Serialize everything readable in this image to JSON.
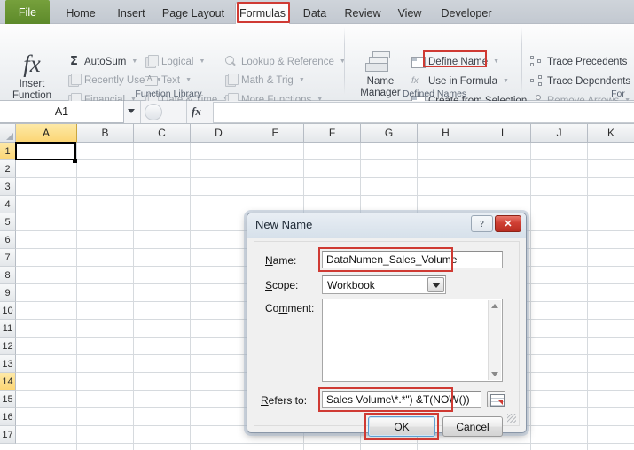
{
  "ribbon": {
    "tabs": [
      {
        "label": "File",
        "kind": "file"
      },
      {
        "label": "Home",
        "kind": "normal"
      },
      {
        "label": "Insert",
        "kind": "normal"
      },
      {
        "label": "Page Layout",
        "kind": "normal"
      },
      {
        "label": "Formulas",
        "kind": "active"
      },
      {
        "label": "Data",
        "kind": "normal"
      },
      {
        "label": "Review",
        "kind": "normal"
      },
      {
        "label": "View",
        "kind": "normal"
      },
      {
        "label": "Developer",
        "kind": "normal"
      }
    ],
    "groups": [
      {
        "label": "Function Library"
      },
      {
        "label": "Defined Names"
      },
      {
        "label": "For"
      }
    ],
    "insert_function": {
      "line1": "Insert",
      "line2": "Function",
      "icon": "fx-icon"
    },
    "name_manager": {
      "line1": "Name",
      "line2": "Manager",
      "icon": "name-manager-icon"
    },
    "function_library_items": [
      {
        "label": "AutoSum",
        "icon": "sigma-icon",
        "caret": true,
        "enabled": true
      },
      {
        "label": "Recently Used",
        "icon": "book-icon",
        "caret": true,
        "enabled": false
      },
      {
        "label": "Financial",
        "icon": "book-icon",
        "caret": true,
        "enabled": false
      },
      {
        "label": "Logical",
        "icon": "book-icon",
        "caret": true,
        "enabled": false
      },
      {
        "label": "Text",
        "icon": "text-icon",
        "caret": true,
        "enabled": false
      },
      {
        "label": "Date & Time",
        "icon": "book-icon",
        "caret": true,
        "enabled": false
      },
      {
        "label": "Lookup & Reference",
        "icon": "lookup-icon",
        "caret": true,
        "enabled": false
      },
      {
        "label": "Math & Trig",
        "icon": "book-icon",
        "caret": true,
        "enabled": false
      },
      {
        "label": "More Functions",
        "icon": "book-icon",
        "caret": true,
        "enabled": false
      }
    ],
    "defined_names_items": [
      {
        "label": "Define Name",
        "icon": "define-name-icon",
        "caret": true,
        "highlighted": true
      },
      {
        "label": "Use in Formula",
        "icon": "use-in-formula-icon",
        "caret": true,
        "highlighted": false
      },
      {
        "label": "Create from Selection",
        "icon": "create-from-selection-icon",
        "caret": false,
        "highlighted": false
      }
    ],
    "formula_auditing_items": [
      {
        "label": "Trace Precedents",
        "icon": "trace-precedents-icon",
        "caret": false
      },
      {
        "label": "Trace Dependents",
        "icon": "trace-dependents-icon",
        "caret": false
      },
      {
        "label": "Remove Arrows",
        "icon": "remove-arrows-icon",
        "caret": true
      }
    ]
  },
  "formula_bar": {
    "name_box_value": "A1",
    "fx_label": "fx",
    "formula_value": ""
  },
  "grid": {
    "columns": [
      "A",
      "B",
      "C",
      "D",
      "E",
      "F",
      "G",
      "H",
      "I",
      "J",
      "K"
    ],
    "selected_column": "A",
    "rows": [
      "1",
      "2",
      "3",
      "4",
      "5",
      "6",
      "7",
      "8",
      "9",
      "10",
      "11",
      "12",
      "13",
      "14",
      "15",
      "16",
      "17"
    ],
    "highlighted_rows": [
      "1",
      "14"
    ],
    "active_cell": "A1"
  },
  "dialog": {
    "title": "New Name",
    "help_label": "?",
    "close_label": "✕",
    "fields": {
      "name": {
        "label": "Name:",
        "underline": "N",
        "value": "DataNumen_Sales_Volume",
        "highlighted": true
      },
      "scope": {
        "label": "Scope:",
        "underline": "S",
        "value": "Workbook",
        "options": [
          "Workbook"
        ]
      },
      "comment": {
        "label": "Comment:",
        "underline": "m",
        "value": ""
      },
      "refers_to": {
        "label": "Refers to:",
        "underline": "R",
        "value": "Sales Volume\\*.*\") &T(NOW())",
        "highlighted": true
      }
    },
    "buttons": {
      "ok": {
        "label": "OK",
        "highlighted": true
      },
      "cancel": {
        "label": "Cancel",
        "highlighted": false
      }
    }
  },
  "colors": {
    "accent_red": "#cf3a33",
    "file_tab_green": "#5d8a2a",
    "selection_yellow": "#fcd675"
  }
}
